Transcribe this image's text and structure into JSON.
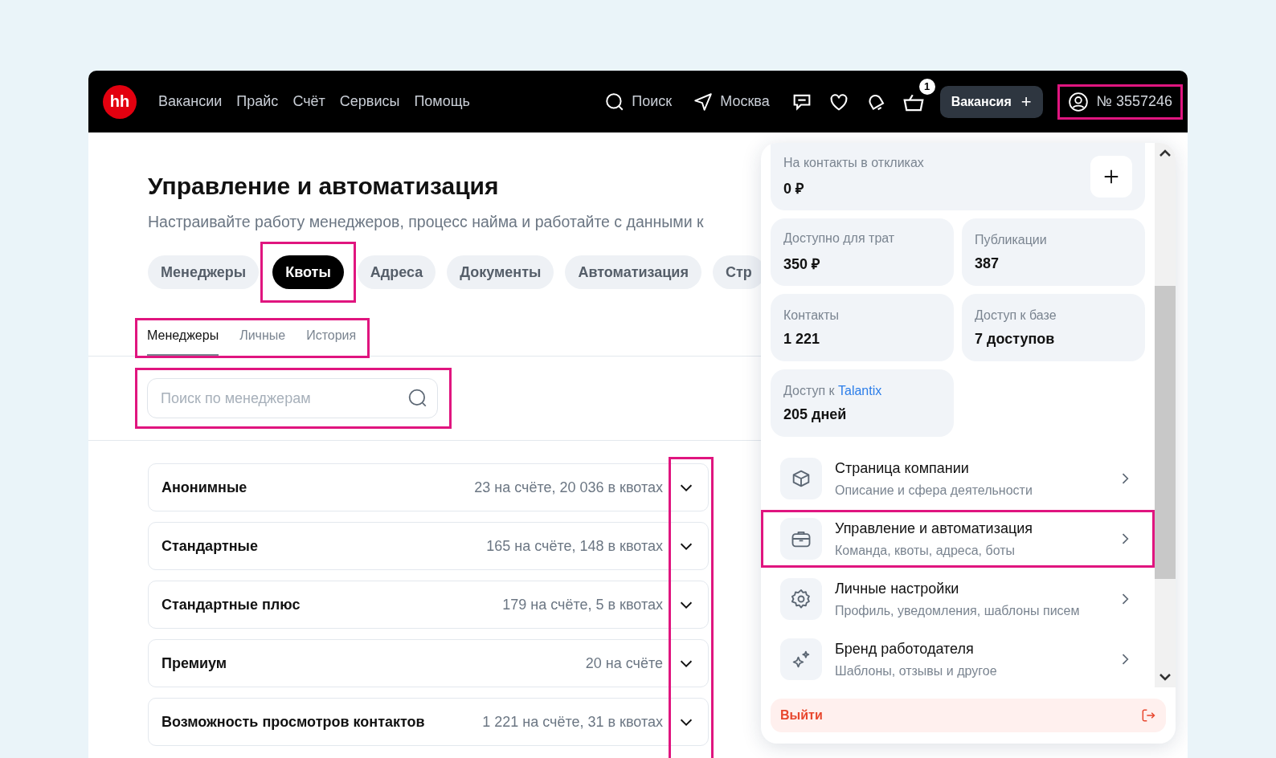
{
  "nav": {
    "logo": "hh",
    "links": [
      "Вакансии",
      "Прайс",
      "Счёт",
      "Сервисы",
      "Помощь"
    ],
    "search": "Поиск",
    "city": "Москва",
    "cart_badge": "1",
    "create_button": "Вакансия",
    "create_icon": "+",
    "account": {
      "label": "№ 3557246",
      "highlighted": true
    }
  },
  "page": {
    "title": "Управление и автоматизация",
    "subtitle": "Настраивайте работу менеджеров, процесс найма и работайте с данными к",
    "tabs": [
      {
        "label": "Менеджеры",
        "selected": false,
        "highlighted": false
      },
      {
        "label": "Квоты",
        "selected": true,
        "highlighted": true
      },
      {
        "label": "Адреса",
        "selected": false,
        "highlighted": false
      },
      {
        "label": "Документы",
        "selected": false,
        "highlighted": false
      },
      {
        "label": "Автоматизация",
        "selected": false,
        "highlighted": false
      },
      {
        "label": "Стр",
        "selected": false,
        "highlighted": false
      }
    ],
    "subtabs": {
      "highlighted": true,
      "items": [
        {
          "label": "Менеджеры",
          "selected": true
        },
        {
          "label": "Личные",
          "selected": false
        },
        {
          "label": "История",
          "selected": false
        }
      ]
    },
    "search": {
      "placeholder": "Поиск по менеджерам",
      "highlighted": true
    },
    "quotas": {
      "chevrons_highlighted": true,
      "rows": [
        {
          "name": "Анонимные",
          "summary": "23 на счёте, 20 036 в квотах",
          "expanded": false
        },
        {
          "name": "Стандартные",
          "summary": "165 на счёте, 148 в квотах",
          "expanded": false
        },
        {
          "name": "Стандартные плюс",
          "summary": "179 на счёте, 5 в квотах",
          "expanded": false
        },
        {
          "name": "Премиум",
          "summary": "20 на счёте",
          "expanded": false
        },
        {
          "name": "Возможность просмотров контактов",
          "summary": "1 221 на счёте, 31 в квотах",
          "expanded": false
        }
      ]
    }
  },
  "account_menu": {
    "top_card": {
      "label": "На контакты в откликах",
      "value": "0 ₽"
    },
    "cards": [
      {
        "label": "Доступно для трат",
        "value": "350 ₽"
      },
      {
        "label": "Публикации",
        "value": "387"
      },
      {
        "label": "Контакты",
        "value": "1 221"
      },
      {
        "label": "Доступ к базе",
        "value": "7 доступов"
      },
      {
        "label": "Доступ к",
        "link": "Talantix",
        "value": "205 дней"
      }
    ],
    "items": [
      {
        "title": "Страница компании",
        "subtitle": "Описание и сфера деятельности",
        "highlighted": false
      },
      {
        "title": "Управление и автоматизация",
        "subtitle": "Команда, квоты, адреса, боты",
        "highlighted": true
      },
      {
        "title": "Личные настройки",
        "subtitle": "Профиль, уведомления, шаблоны писем",
        "highlighted": false
      },
      {
        "title": "Бренд работодателя",
        "subtitle": "Шаблоны, отзывы и другое",
        "highlighted": false
      }
    ],
    "logout": "Выйти"
  }
}
